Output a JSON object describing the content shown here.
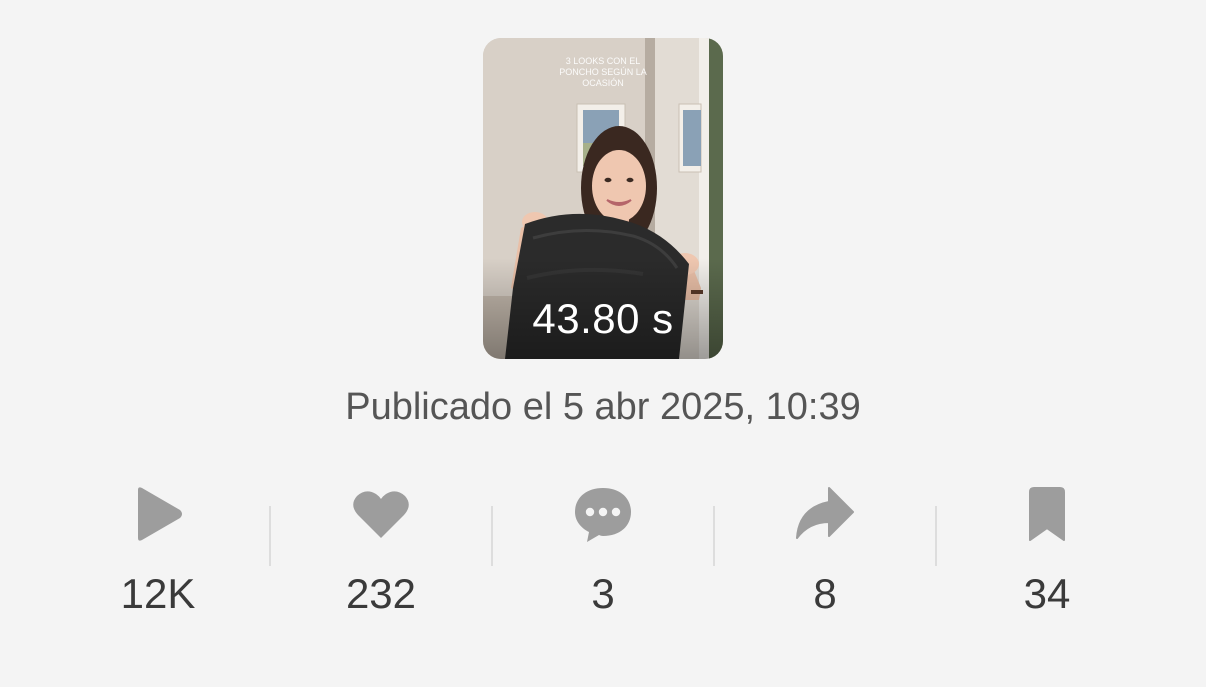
{
  "video": {
    "overlay_caption": "3 looks con el poncho según la ocasión",
    "duration": "43.80 s"
  },
  "published_label": "Publicado el 5 abr 2025, 10:39",
  "stats": {
    "plays": {
      "icon": "play-icon",
      "value": "12K"
    },
    "likes": {
      "icon": "heart-icon",
      "value": "232"
    },
    "comments": {
      "icon": "comment-icon",
      "value": "3"
    },
    "shares": {
      "icon": "share-icon",
      "value": "8"
    },
    "saves": {
      "icon": "bookmark-icon",
      "value": "34"
    }
  },
  "colors": {
    "background": "#f4f4f4",
    "icon": "#9d9d9d",
    "text": "#3a3a3a",
    "subtext": "#555555"
  }
}
